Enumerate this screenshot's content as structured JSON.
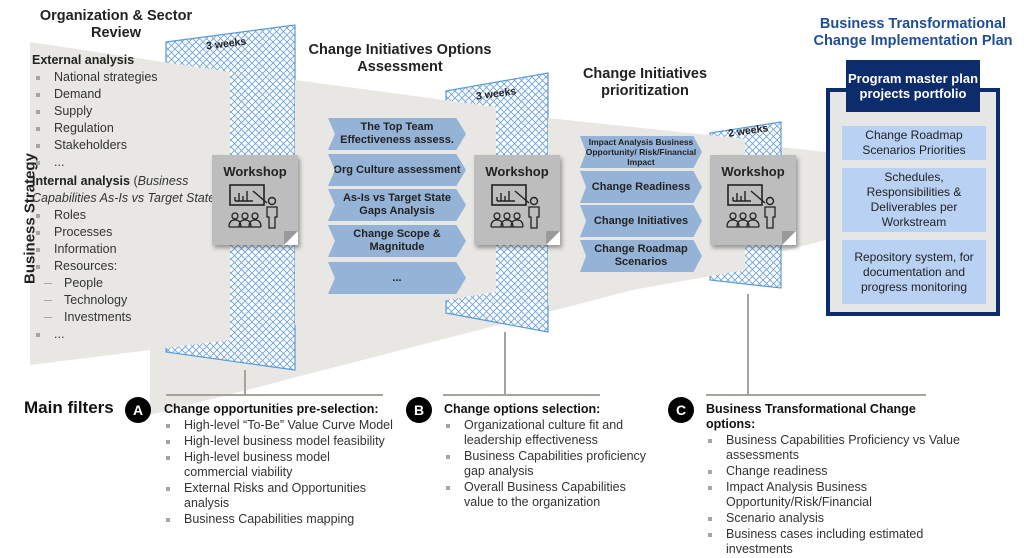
{
  "stages": [
    {
      "title": "Organization & Sector Review",
      "duration": "3 weeks"
    },
    {
      "title": "Change Initiatives Options Assessment",
      "duration": "3 weeks"
    },
    {
      "title": "Change Initiatives prioritization",
      "duration": "2 weeks"
    },
    {
      "title": "Business Transformational Change Implementation Plan"
    }
  ],
  "side_label": "Business Strategy",
  "review_panel": {
    "external_heading": "External analysis",
    "external_items": [
      "National strategies",
      "Demand",
      "Supply",
      "Regulation",
      "Stakeholders",
      "..."
    ],
    "internal_heading_bold": "Internal analysis",
    "internal_heading_open": " (",
    "internal_heading_italic": "Business Capabilities As-Is vs Target State",
    "internal_heading_close": ")",
    "internal_items": [
      "Roles",
      "Processes",
      "Information",
      "Resources:"
    ],
    "resource_subitems": [
      "People",
      "Technology",
      "Investments"
    ],
    "internal_trailing": "..."
  },
  "workshop_label": "Workshop",
  "workshop_icon": "presentation-icon",
  "assessment_chevrons": [
    "The Top Team Effectiveness assess.",
    "Org Culture assessment",
    "As-Is vs Target State Gaps Analysis",
    "Change Scope & Magnitude",
    "..."
  ],
  "prioritization_chevrons": [
    "Impact Analysis Business Opportunity/ Risk/Financial Impact",
    "Change Readiness",
    "Change Initiatives",
    "Change Roadmap Scenarios"
  ],
  "plan": {
    "header": "Program master plan projects portfolio",
    "items": [
      "Change Roadmap Scenarios Priorities",
      "Schedules, Responsibilities & Deliverables per Workstream",
      "Repository system, for documentation and progress monitoring"
    ]
  },
  "filters": {
    "title": "Main filters",
    "groups": [
      {
        "badge": "A",
        "heading": "Change opportunities pre-selection:",
        "items": [
          "High-level “To-Be” Value Curve Model",
          "High-level business model feasibility",
          "High-level business model commercial viability",
          "External Risks and Opportunities analysis",
          "Business Capabilities mapping"
        ]
      },
      {
        "badge": "B",
        "heading": "Change options selection:",
        "items": [
          "Organizational culture fit and leadership effectiveness",
          "Business Capabilities proficiency gap analysis",
          "Overall Business Capabilities value to the organization"
        ]
      },
      {
        "badge": "C",
        "heading": "Business Transformational Change options:",
        "items": [
          "Business Capabilities Proficiency vs Value assessments",
          "Change readiness",
          "Impact Analysis Business Opportunity/Risk/Financial",
          "Scenario analysis",
          "Business cases including estimated investments"
        ]
      }
    ]
  },
  "colors": {
    "funnel_gray": "#e8e7e4",
    "hatch_blue": "#5b9bd5",
    "chevron_blue": "#95b3d7",
    "plan_navy": "#0d2c6b",
    "plan_item": "#b9d1f3",
    "title_blue": "#1f4e96"
  }
}
